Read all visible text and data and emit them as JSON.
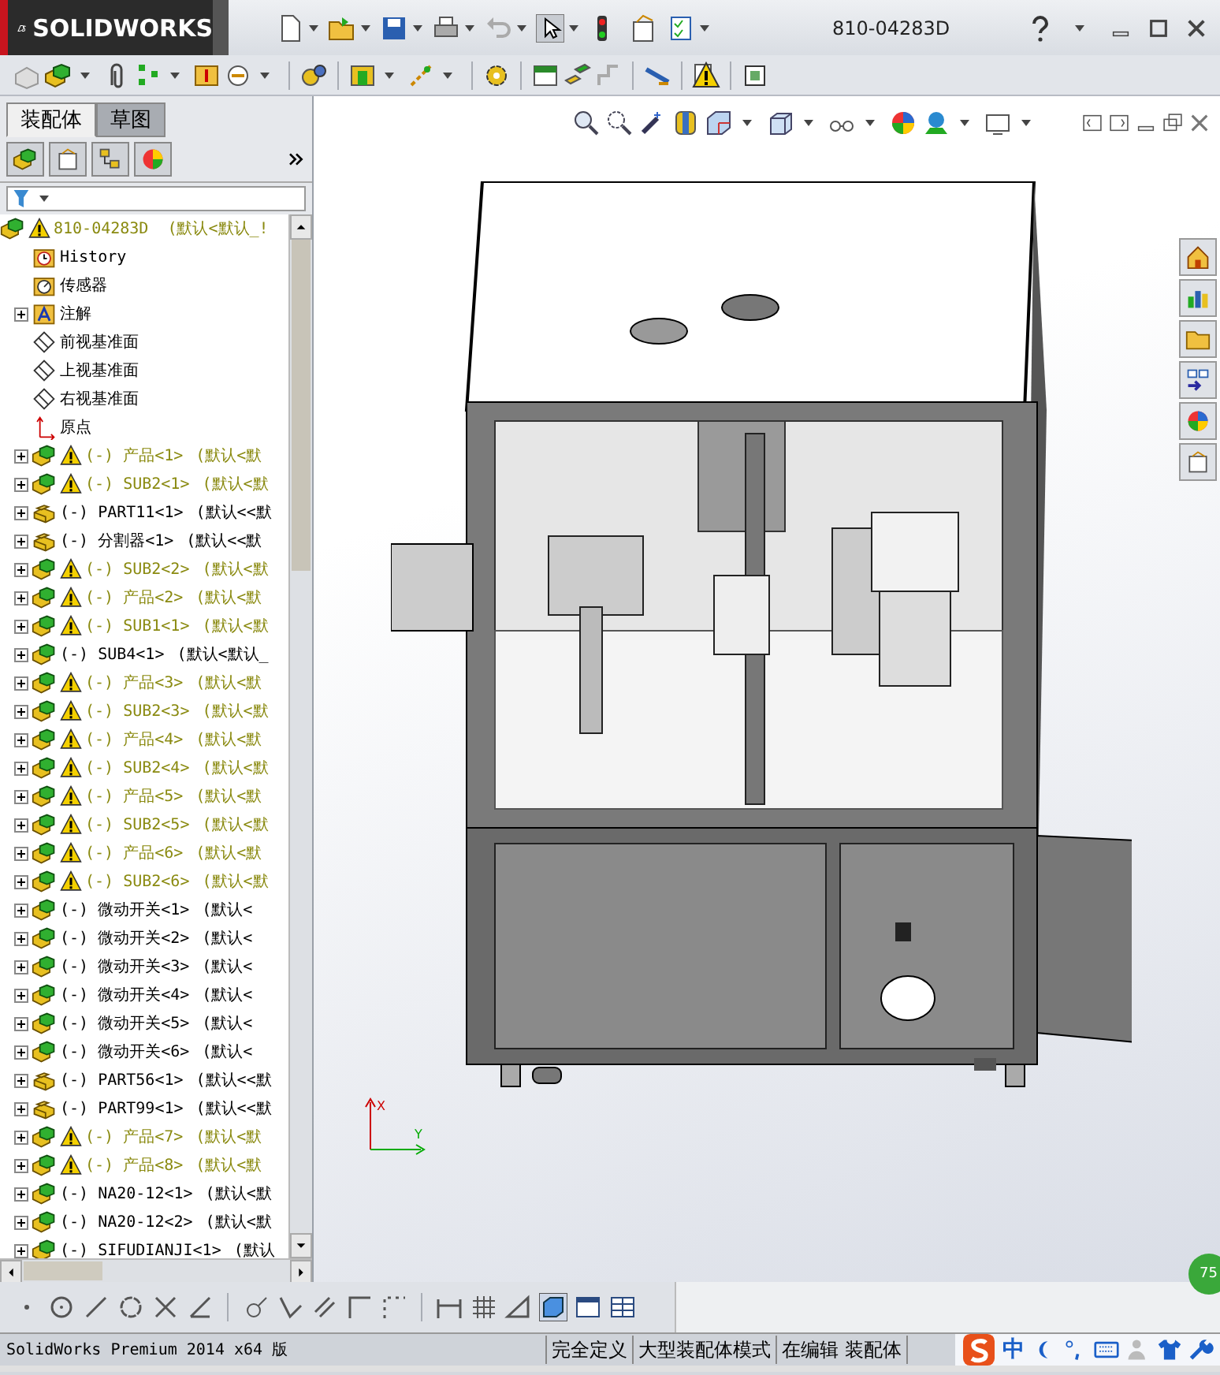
{
  "window": {
    "app_name": "SOLIDWORKS",
    "title": "810-04283D"
  },
  "panel_tabs": [
    {
      "label": "装配体",
      "selected": true
    },
    {
      "label": "草图",
      "selected": false
    }
  ],
  "tree": {
    "root": {
      "kind": "assembly",
      "name": "810-04283D",
      "config": "(默认<默认_!",
      "warning": true,
      "children": [
        {
          "kind": "history",
          "name": "History"
        },
        {
          "kind": "sensor",
          "name": "传感器"
        },
        {
          "kind": "annotation",
          "name": "注解",
          "expanded": false
        },
        {
          "kind": "plane",
          "name": "前视基准面"
        },
        {
          "kind": "plane",
          "name": "上视基准面"
        },
        {
          "kind": "plane",
          "name": "右视基准面"
        },
        {
          "kind": "origin",
          "name": "原点"
        },
        {
          "kind": "assembly",
          "name": "(-) 产品<1>",
          "config": "(默认<默",
          "warning": true,
          "expanded": false
        },
        {
          "kind": "assembly",
          "name": "(-) SUB2<1>",
          "config": "(默认<默",
          "warning": true,
          "expanded": false
        },
        {
          "kind": "part",
          "name": "(-) PART11<1>",
          "config": "(默认<<默",
          "warning": false,
          "expanded": false
        },
        {
          "kind": "part",
          "name": "(-) 分割器<1>",
          "config": "(默认<<默",
          "warning": false,
          "expanded": false
        },
        {
          "kind": "assembly",
          "name": "(-) SUB2<2>",
          "config": "(默认<默",
          "warning": true,
          "expanded": false
        },
        {
          "kind": "assembly",
          "name": "(-) 产品<2>",
          "config": "(默认<默",
          "warning": true,
          "expanded": false
        },
        {
          "kind": "assembly",
          "name": "(-) SUB1<1>",
          "config": "(默认<默",
          "warning": true,
          "expanded": false
        },
        {
          "kind": "assembly",
          "name": "(-) SUB4<1>",
          "config": "(默认<默认_",
          "warning": false,
          "expanded": false
        },
        {
          "kind": "assembly",
          "name": "(-) 产品<3>",
          "config": "(默认<默",
          "warning": true,
          "expanded": false
        },
        {
          "kind": "assembly",
          "name": "(-) SUB2<3>",
          "config": "(默认<默",
          "warning": true,
          "expanded": false
        },
        {
          "kind": "assembly",
          "name": "(-) 产品<4>",
          "config": "(默认<默",
          "warning": true,
          "expanded": false
        },
        {
          "kind": "assembly",
          "name": "(-) SUB2<4>",
          "config": "(默认<默",
          "warning": true,
          "expanded": false
        },
        {
          "kind": "assembly",
          "name": "(-) 产品<5>",
          "config": "(默认<默",
          "warning": true,
          "expanded": false
        },
        {
          "kind": "assembly",
          "name": "(-) SUB2<5>",
          "config": "(默认<默",
          "warning": true,
          "expanded": false
        },
        {
          "kind": "assembly",
          "name": "(-) 产品<6>",
          "config": "(默认<默",
          "warning": true,
          "expanded": false
        },
        {
          "kind": "assembly",
          "name": "(-) SUB2<6>",
          "config": "(默认<默",
          "warning": true,
          "expanded": false
        },
        {
          "kind": "assembly",
          "name": "(-) 微动开关<1>",
          "config": "(默认<",
          "warning": false,
          "expanded": false
        },
        {
          "kind": "assembly",
          "name": "(-) 微动开关<2>",
          "config": "(默认<",
          "warning": false,
          "expanded": false
        },
        {
          "kind": "assembly",
          "name": "(-) 微动开关<3>",
          "config": "(默认<",
          "warning": false,
          "expanded": false
        },
        {
          "kind": "assembly",
          "name": "(-) 微动开关<4>",
          "config": "(默认<",
          "warning": false,
          "expanded": false
        },
        {
          "kind": "assembly",
          "name": "(-) 微动开关<5>",
          "config": "(默认<",
          "warning": false,
          "expanded": false
        },
        {
          "kind": "assembly",
          "name": "(-) 微动开关<6>",
          "config": "(默认<",
          "warning": false,
          "expanded": false
        },
        {
          "kind": "part",
          "name": "(-) PART56<1>",
          "config": "(默认<<默",
          "warning": false,
          "expanded": false
        },
        {
          "kind": "part",
          "name": "(-) PART99<1>",
          "config": "(默认<<默",
          "warning": false,
          "expanded": false
        },
        {
          "kind": "assembly",
          "name": "(-) 产品<7>",
          "config": "(默认<默",
          "warning": true,
          "expanded": false
        },
        {
          "kind": "assembly",
          "name": "(-) 产品<8>",
          "config": "(默认<默",
          "warning": true,
          "expanded": false
        },
        {
          "kind": "assembly",
          "name": "(-) NA20-12<1>",
          "config": "(默认<默",
          "warning": false,
          "expanded": false
        },
        {
          "kind": "assembly",
          "name": "(-) NA20-12<2>",
          "config": "(默认<默",
          "warning": false,
          "expanded": false
        },
        {
          "kind": "assembly",
          "name": "(-) SIFUDIANJI<1>",
          "config": "(默认",
          "warning": false,
          "expanded": false
        }
      ]
    }
  },
  "triad": {
    "vertical": "X",
    "horizontal": "Y"
  },
  "status_bar": {
    "product": "SolidWorks Premium 2014 x64 版",
    "cells": [
      "完全定义",
      "大型装配体模式",
      "在编辑 装配体"
    ]
  },
  "ime": {
    "mode": "中"
  },
  "badge": "75"
}
